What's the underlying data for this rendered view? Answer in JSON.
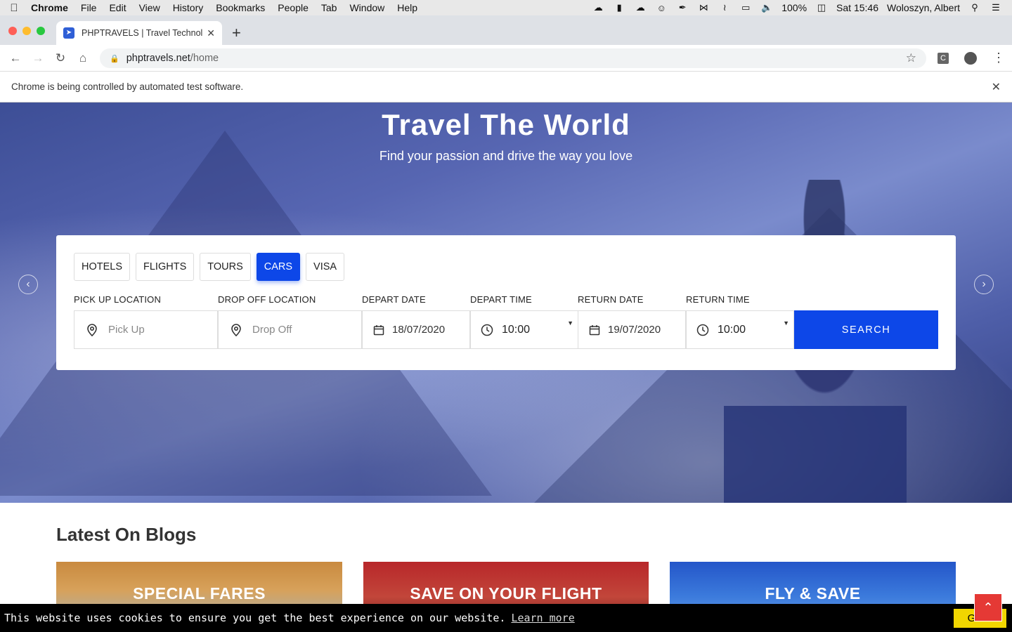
{
  "menubar": {
    "app": "Chrome",
    "items": [
      "File",
      "Edit",
      "View",
      "History",
      "Bookmarks",
      "People",
      "Tab",
      "Window",
      "Help"
    ],
    "battery": "100%",
    "clock": "Sat 15:46",
    "user": "Woloszyn, Albert"
  },
  "browser": {
    "tab_title": "PHPTRAVELS | Travel Technolo",
    "url_host": "phptravels.net",
    "url_path": "/home",
    "infobar_text": "Chrome is being controlled by automated test software."
  },
  "hero": {
    "title": "Travel The World",
    "subtitle": "Find your passion and drive the way you love"
  },
  "search": {
    "tabs": [
      "HOTELS",
      "FLIGHTS",
      "TOURS",
      "CARS",
      "VISA"
    ],
    "active_tab": "CARS",
    "pickup_label": "PICK UP LOCATION",
    "pickup_placeholder": "Pick Up",
    "dropoff_label": "DROP OFF LOCATION",
    "dropoff_placeholder": "Drop Off",
    "depart_date_label": "DEPART DATE",
    "depart_date": "18/07/2020",
    "depart_time_label": "DEPART TIME",
    "depart_time": "10:00",
    "return_date_label": "RETURN DATE",
    "return_date": "19/07/2020",
    "return_time_label": "RETURN TIME",
    "return_time": "10:00",
    "button": "SEARCH"
  },
  "blogs": {
    "heading": "Latest On Blogs",
    "cards": [
      "SPECIAL FARES",
      "SAVE ON YOUR FLIGHT",
      "FLY & SAVE"
    ]
  },
  "cookie": {
    "text": "This website uses cookies to ensure you get the best experience on our website.",
    "learn_more": "Learn more",
    "button": "Got it"
  },
  "colors": {
    "accent": "#0d47e8",
    "cookie_button": "#f1d600",
    "scroll_top": "#e53935"
  }
}
